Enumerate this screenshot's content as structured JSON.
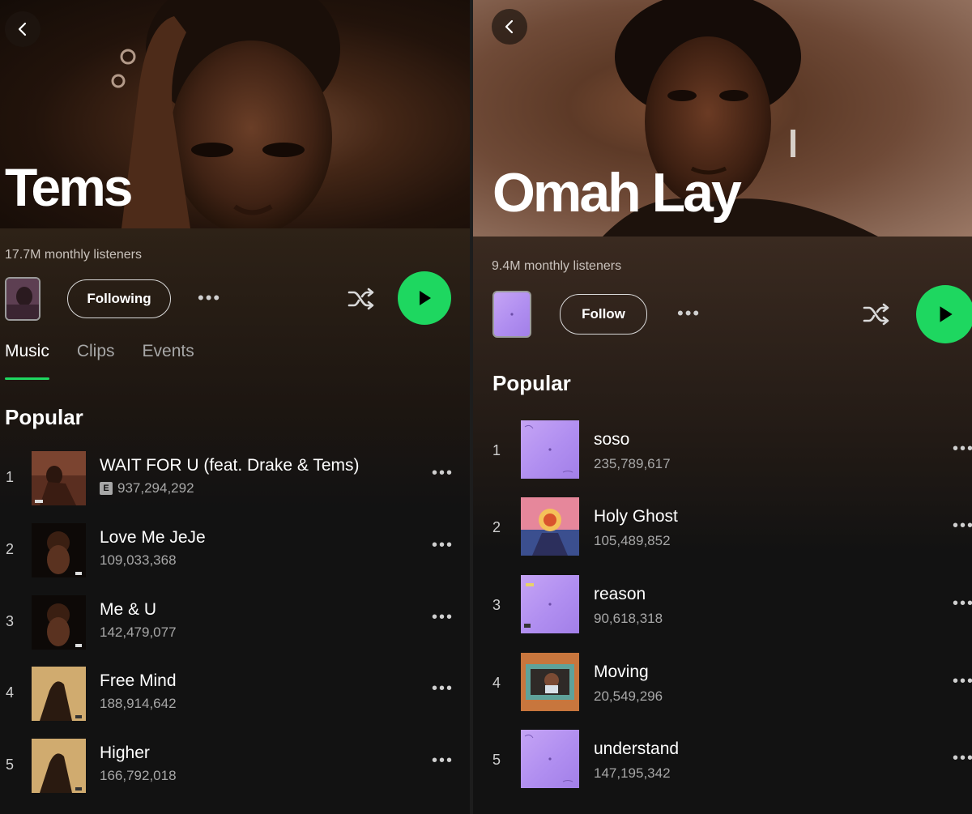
{
  "left": {
    "artist_name": "Tems",
    "listeners": "17.7M monthly listeners",
    "follow_label": "Following",
    "more_label": "•••",
    "tabs": [
      {
        "label": "Music"
      },
      {
        "label": "Clips"
      },
      {
        "label": "Events"
      }
    ],
    "section_title": "Popular",
    "tracks": [
      {
        "num": "1",
        "title": "WAIT FOR U (feat. Drake & Tems)",
        "plays": "937,294,292",
        "explicit": "E"
      },
      {
        "num": "2",
        "title": "Love Me JeJe",
        "plays": "109,033,368"
      },
      {
        "num": "3",
        "title": "Me & U",
        "plays": "142,479,077"
      },
      {
        "num": "4",
        "title": "Free Mind",
        "plays": "188,914,642"
      },
      {
        "num": "5",
        "title": "Higher",
        "plays": "166,792,018"
      }
    ]
  },
  "right": {
    "artist_name": "Omah Lay",
    "listeners": "9.4M monthly listeners",
    "follow_label": "Follow",
    "more_label": "•••",
    "section_title": "Popular",
    "tracks": [
      {
        "num": "1",
        "title": "soso",
        "plays": "235,789,617"
      },
      {
        "num": "2",
        "title": "Holy Ghost",
        "plays": "105,489,852"
      },
      {
        "num": "3",
        "title": "reason",
        "plays": "90,618,318"
      },
      {
        "num": "4",
        "title": "Moving",
        "plays": "20,549,296"
      },
      {
        "num": "5",
        "title": "understand",
        "plays": "147,195,342"
      }
    ]
  },
  "icons": {
    "back": "chevron-left-icon",
    "shuffle": "shuffle-icon",
    "play": "play-icon",
    "more": "more-dots-icon"
  },
  "colors": {
    "accent": "#1ed760",
    "background": "#121212",
    "cover_lilac": "#b08ef0"
  }
}
